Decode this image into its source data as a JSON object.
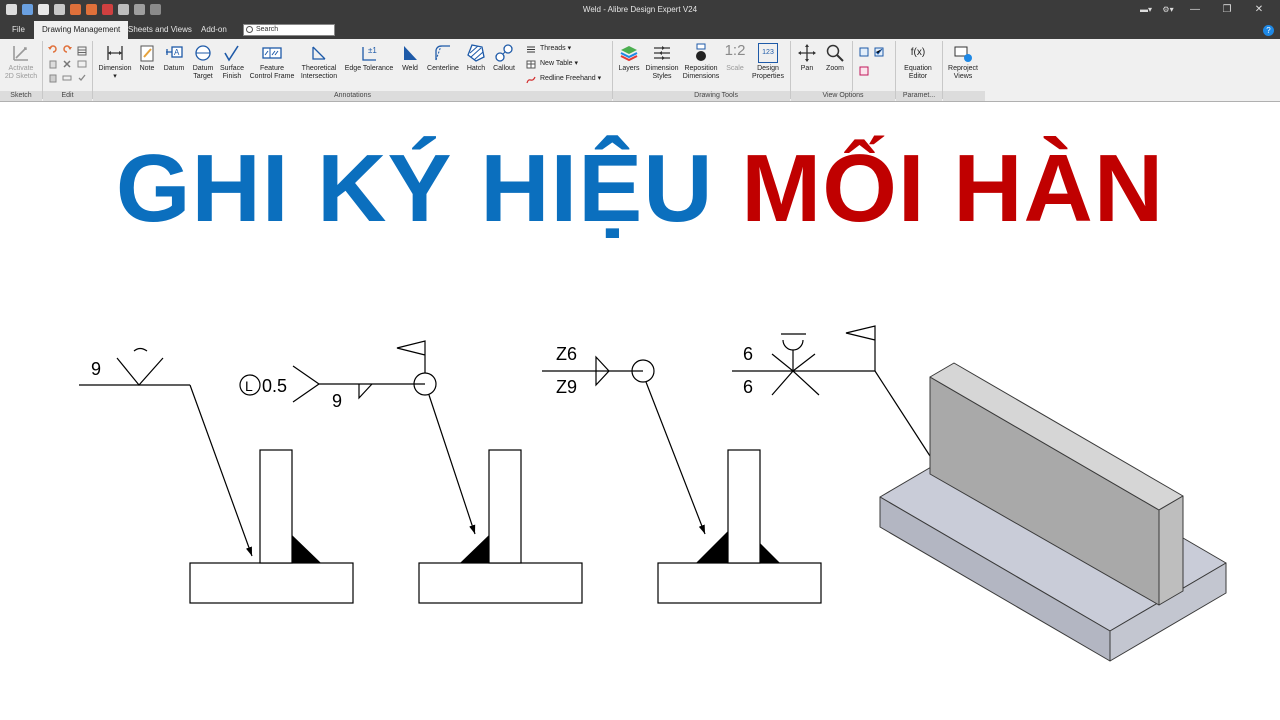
{
  "app": {
    "window_title": "Weld - Alibre Design Expert V24"
  },
  "tabs": [
    {
      "label": "File"
    },
    {
      "label": "Drawing Management"
    },
    {
      "label": "Sheets and Views"
    },
    {
      "label": "Add-on"
    }
  ],
  "search": {
    "placeholder": "Search"
  },
  "ribbon": {
    "groups": {
      "sketch": "Sketch",
      "edit": "Edit",
      "annotations": "Annotations",
      "drawing_tools": "Drawing Tools",
      "view_options": "View Options",
      "parameters": "Paramet..."
    },
    "buttons": {
      "activate_sketch": [
        "Activate",
        "2D Sketch"
      ],
      "dimension": "Dimension",
      "note": "Note",
      "datum": "Datum",
      "datum_target": [
        "Datum",
        "Target"
      ],
      "surface_finish": [
        "Surface",
        "Finish"
      ],
      "feature_control_frame": [
        "Feature",
        "Control Frame"
      ],
      "theoretical_intersection": [
        "Theoretical",
        "Intersection"
      ],
      "edge_tolerance": "Edge Tolerance",
      "weld": "Weld",
      "centerline": "Centerline",
      "hatch": "Hatch",
      "callout": "Callout",
      "threads": "Threads",
      "new_table": "New Table",
      "redline_freehand": "Redline Freehand",
      "layers": "Layers",
      "dimension_styles": [
        "Dimension",
        "Styles"
      ],
      "reposition_dimensions": [
        "Reposition",
        "Dimensions"
      ],
      "scale_value": "1:2",
      "scale": "Scale",
      "design_properties": [
        "Design",
        "Properties"
      ],
      "design_properties_icon_text": "123",
      "pan": "Pan",
      "zoom": "Zoom",
      "equation_editor": [
        "Equation",
        "Editor"
      ],
      "equation_icon_text": "f(x)",
      "reproject_views": [
        "Reproject",
        "Views"
      ]
    }
  },
  "headline": {
    "blue_text": "GHI KÝ HIỆU",
    "red_text": "MỐI HÀN",
    "blue_color": "#0b6fbe",
    "red_color": "#c00000"
  },
  "weld_symbols": {
    "symbol1": {
      "size": "9"
    },
    "symbol2": {
      "length_prefix": "L",
      "length": "0.5",
      "size": "9"
    },
    "symbol3": {
      "top": "Z6",
      "bottom": "Z9"
    },
    "symbol4": {
      "top": "6",
      "bottom": "6"
    }
  }
}
